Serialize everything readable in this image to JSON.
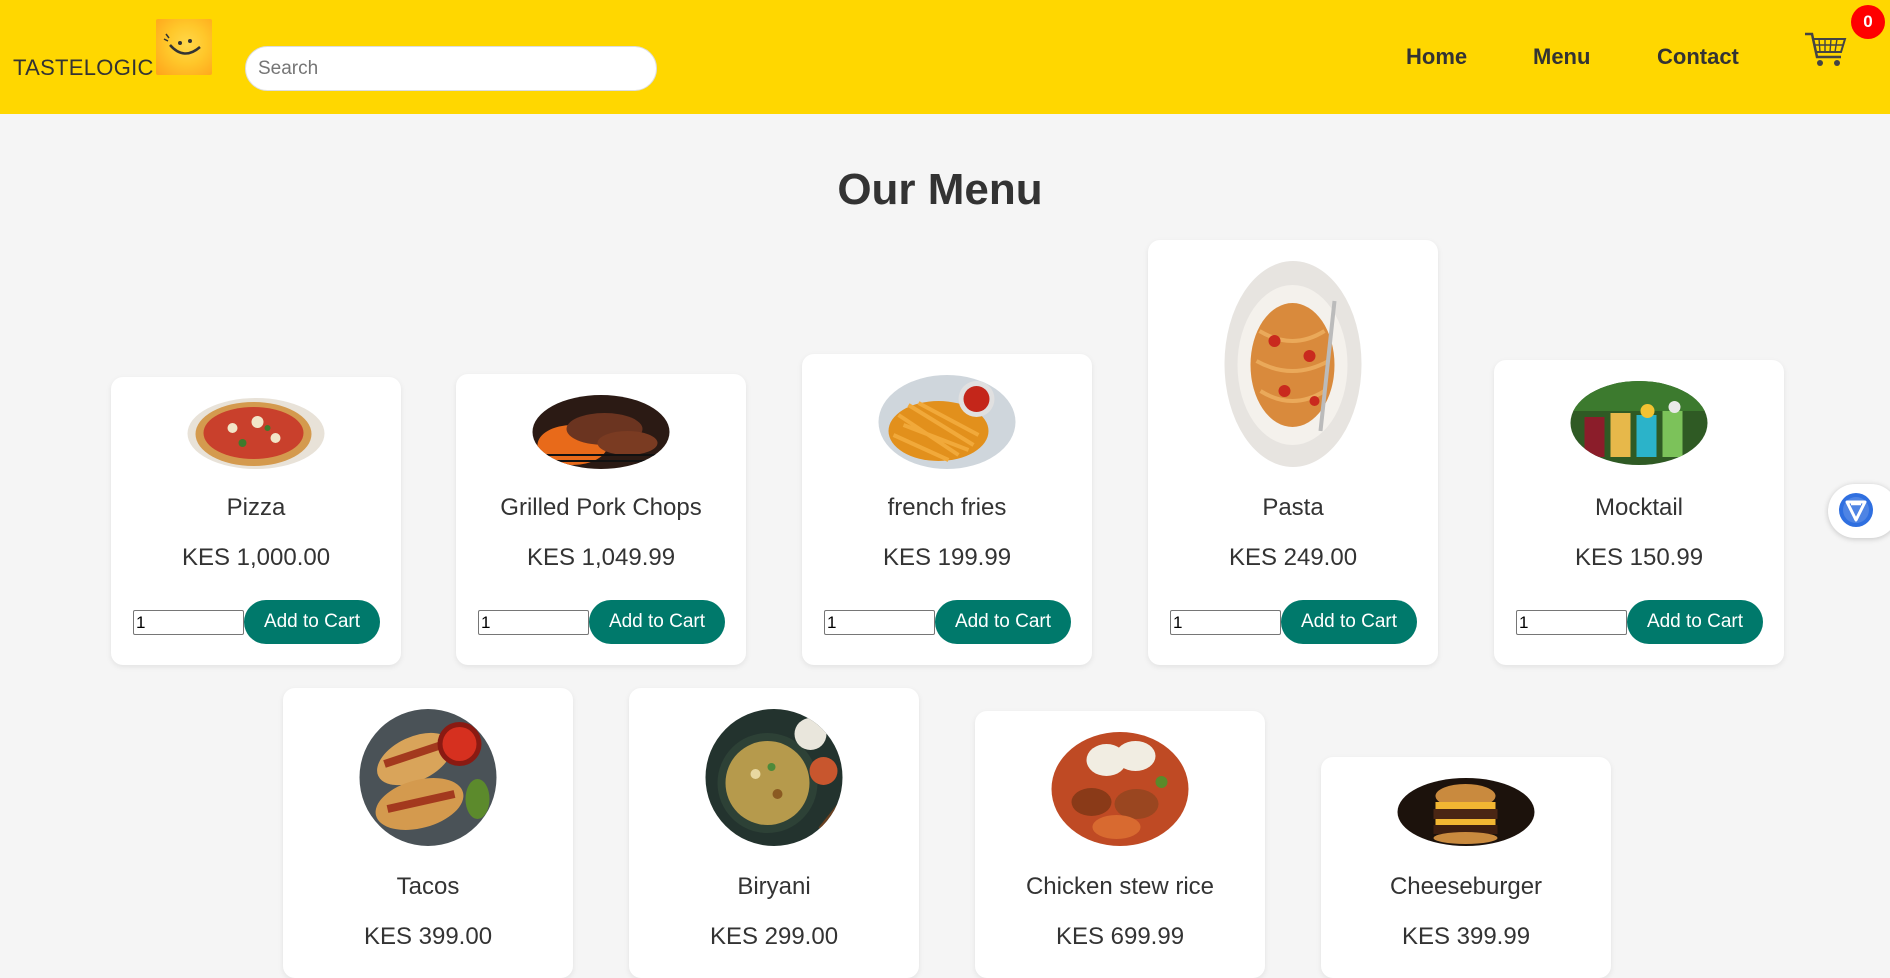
{
  "header": {
    "brand": "TASTELOGIC",
    "search_placeholder": "Search",
    "nav": [
      "Home",
      "Menu",
      "Contact"
    ],
    "cart_count": "0",
    "colors": {
      "background": "#ffd700",
      "badge": "#ff0000"
    }
  },
  "main": {
    "title": "Our Menu",
    "add_label": "Add to Cart",
    "button_color": "#00796b",
    "items": [
      {
        "name": "Pizza",
        "price": "KES 1,000.00",
        "qty": "1"
      },
      {
        "name": "Grilled Pork Chops",
        "price": "KES 1,049.99",
        "qty": "1"
      },
      {
        "name": "french fries",
        "price": "KES 199.99",
        "qty": "1"
      },
      {
        "name": "Pasta",
        "price": "KES 249.00",
        "qty": "1"
      },
      {
        "name": "Mocktail",
        "price": "KES 150.99",
        "qty": "1"
      },
      {
        "name": "Tacos",
        "price": "KES 399.00"
      },
      {
        "name": "Biryani",
        "price": "KES 299.00"
      },
      {
        "name": "Chicken stew rice",
        "price": "KES 699.99"
      },
      {
        "name": "Cheeseburger",
        "price": "KES 399.99"
      }
    ]
  },
  "icons": {
    "logo": "smiling-chef-logo",
    "cart": "shopping-cart-icon",
    "widget": "extension-v-icon"
  }
}
